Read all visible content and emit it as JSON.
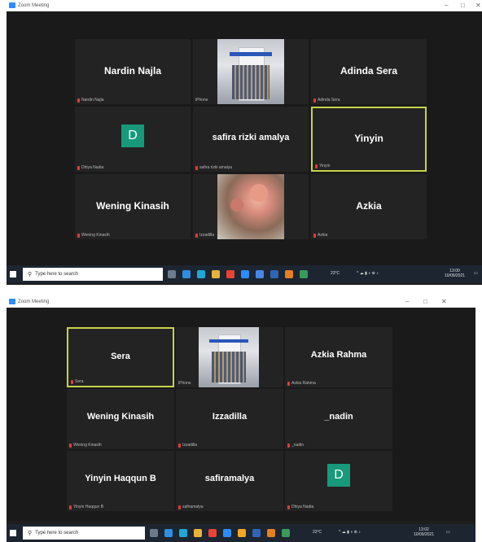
{
  "shots": [
    {
      "window_title": "Zoom Meeting",
      "tiles": [
        {
          "name": "Nardin Najla",
          "label": "Nardin Najla",
          "kind": "name"
        },
        {
          "name": "",
          "label": "iPhone",
          "kind": "building"
        },
        {
          "name": "Adinda Sera",
          "label": "Adinda Sera",
          "kind": "name"
        },
        {
          "name": "",
          "label": "Dhiya Nadia",
          "kind": "avatar",
          "initial": "D"
        },
        {
          "name": "safira rizki amalya",
          "label": "safira rizki amalya",
          "kind": "name"
        },
        {
          "name": "Yinyin",
          "label": "Yinyin",
          "kind": "name",
          "active": true
        },
        {
          "name": "Wening Kinasih",
          "label": "Wening Kinasih",
          "kind": "name"
        },
        {
          "name": "",
          "label": "Izzadilla",
          "kind": "flower"
        },
        {
          "name": "Azkia",
          "label": "Azkia",
          "kind": "name"
        }
      ],
      "taskbar": {
        "search_placeholder": "Type here to search",
        "weather": "23°C",
        "time": "13:00",
        "date": "10/09/2021"
      }
    },
    {
      "window_title": "Zoom Meeting",
      "tiles": [
        {
          "name": "Sera",
          "label": "Sera",
          "kind": "name",
          "active": true
        },
        {
          "name": "",
          "label": "iPhone",
          "kind": "building"
        },
        {
          "name": "Azkia Rahma",
          "label": "Azkia Rahma",
          "kind": "name"
        },
        {
          "name": "Wening Kinasih",
          "label": "Wening Kinasih",
          "kind": "name"
        },
        {
          "name": "Izzadilla",
          "label": "Izzadilla",
          "kind": "name"
        },
        {
          "name": "_nadin",
          "label": "_nadin",
          "kind": "name"
        },
        {
          "name": "Yinyin Haqqun B",
          "label": "Yinyin Haqqun B",
          "kind": "name"
        },
        {
          "name": "safiramalya",
          "label": "safiramalya",
          "kind": "name"
        },
        {
          "name": "",
          "label": "Dhiya Nadia",
          "kind": "avatar",
          "initial": "D"
        }
      ],
      "taskbar": {
        "search_placeholder": "Type here to search",
        "weather": "23°C",
        "time": "13:02",
        "date": "10/09/2021"
      }
    }
  ],
  "colors": {
    "stage": "#1a1a1a",
    "tile": "#232323",
    "active_border": "#c5d34a",
    "avatar": "#169a7a",
    "taskbar": "#1c2530"
  }
}
